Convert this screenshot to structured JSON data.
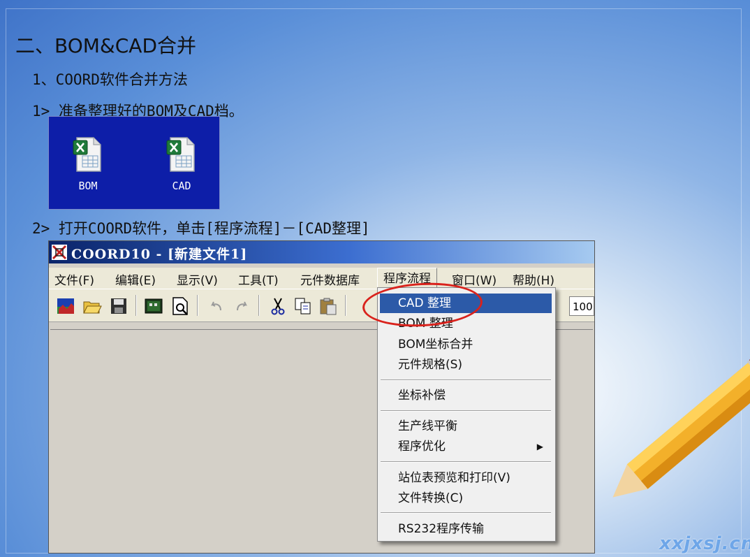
{
  "slide": {
    "heading": "二、BOM&CAD合并",
    "step1": "1、COORD软件合并方法",
    "step2": "1> 准备整理好的BOM及CAD档。",
    "step3": "2> 打开COORD软件，单击[程序流程]－[CAD整理]",
    "watermark": "xxjxsj.cn"
  },
  "desktop": {
    "files": [
      {
        "label": "BOM",
        "icon": "excel-file-icon"
      },
      {
        "label": "CAD",
        "icon": "excel-file-icon"
      }
    ]
  },
  "window": {
    "title": "COORD10 - [新建文件1]",
    "menu": [
      {
        "label": "文件(F)"
      },
      {
        "label": "编辑(E)"
      },
      {
        "label": "显示(V)"
      },
      {
        "label": "工具(T)"
      },
      {
        "label": "元件数据库"
      },
      {
        "label": "程序流程",
        "active": true
      },
      {
        "label": "窗口(W)"
      },
      {
        "label": "帮助(H)"
      }
    ],
    "zoom_value": "100"
  },
  "dropdown": {
    "items": [
      {
        "label": "CAD 整理",
        "highlighted": true
      },
      {
        "label": "BOM 整理"
      },
      {
        "label": "BOM坐标合并"
      },
      {
        "label": "元件规格(S)"
      },
      {
        "label": "坐标补偿"
      },
      {
        "label": "生产线平衡"
      },
      {
        "label": "程序优化",
        "submenu": true
      },
      {
        "label": "站位表预览和打印(V)"
      },
      {
        "label": "文件转换(C)"
      },
      {
        "label": "RS232程序传输"
      }
    ]
  },
  "colors": {
    "highlight": "#2c5aa8",
    "annotation_circle": "#d9221c",
    "desktop_bg": "#0d1ea8"
  }
}
